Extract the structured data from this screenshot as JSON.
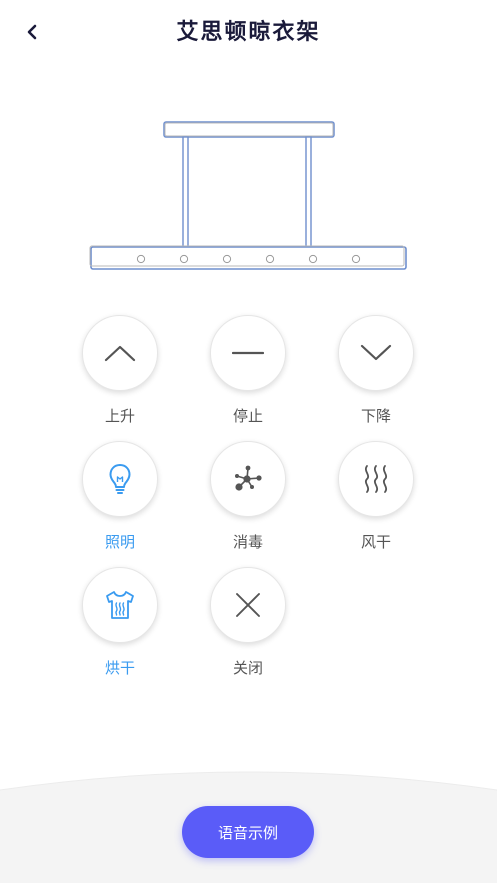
{
  "header": {
    "title": "艾思顿晾衣架"
  },
  "controls": [
    {
      "id": "up",
      "label": "上升",
      "icon": "chevron-up-icon",
      "active": false
    },
    {
      "id": "stop",
      "label": "停止",
      "icon": "minus-icon",
      "active": false
    },
    {
      "id": "down",
      "label": "下降",
      "icon": "chevron-down-icon",
      "active": false
    },
    {
      "id": "light",
      "label": "照明",
      "icon": "lightbulb-icon",
      "active": true
    },
    {
      "id": "disinfect",
      "label": "消毒",
      "icon": "molecule-icon",
      "active": false
    },
    {
      "id": "air-dry",
      "label": "风干",
      "icon": "wind-waves-icon",
      "active": false
    },
    {
      "id": "heat-dry",
      "label": "烘干",
      "icon": "shirt-heat-icon",
      "active": true
    },
    {
      "id": "close",
      "label": "关闭",
      "icon": "close-icon",
      "active": false
    }
  ],
  "voice_button": {
    "label": "语音示例"
  },
  "colors": {
    "active": "#3a9bf0",
    "inactive_icon": "#555555",
    "voice_button": "#5a5cf8",
    "title": "#1a1a3a"
  }
}
